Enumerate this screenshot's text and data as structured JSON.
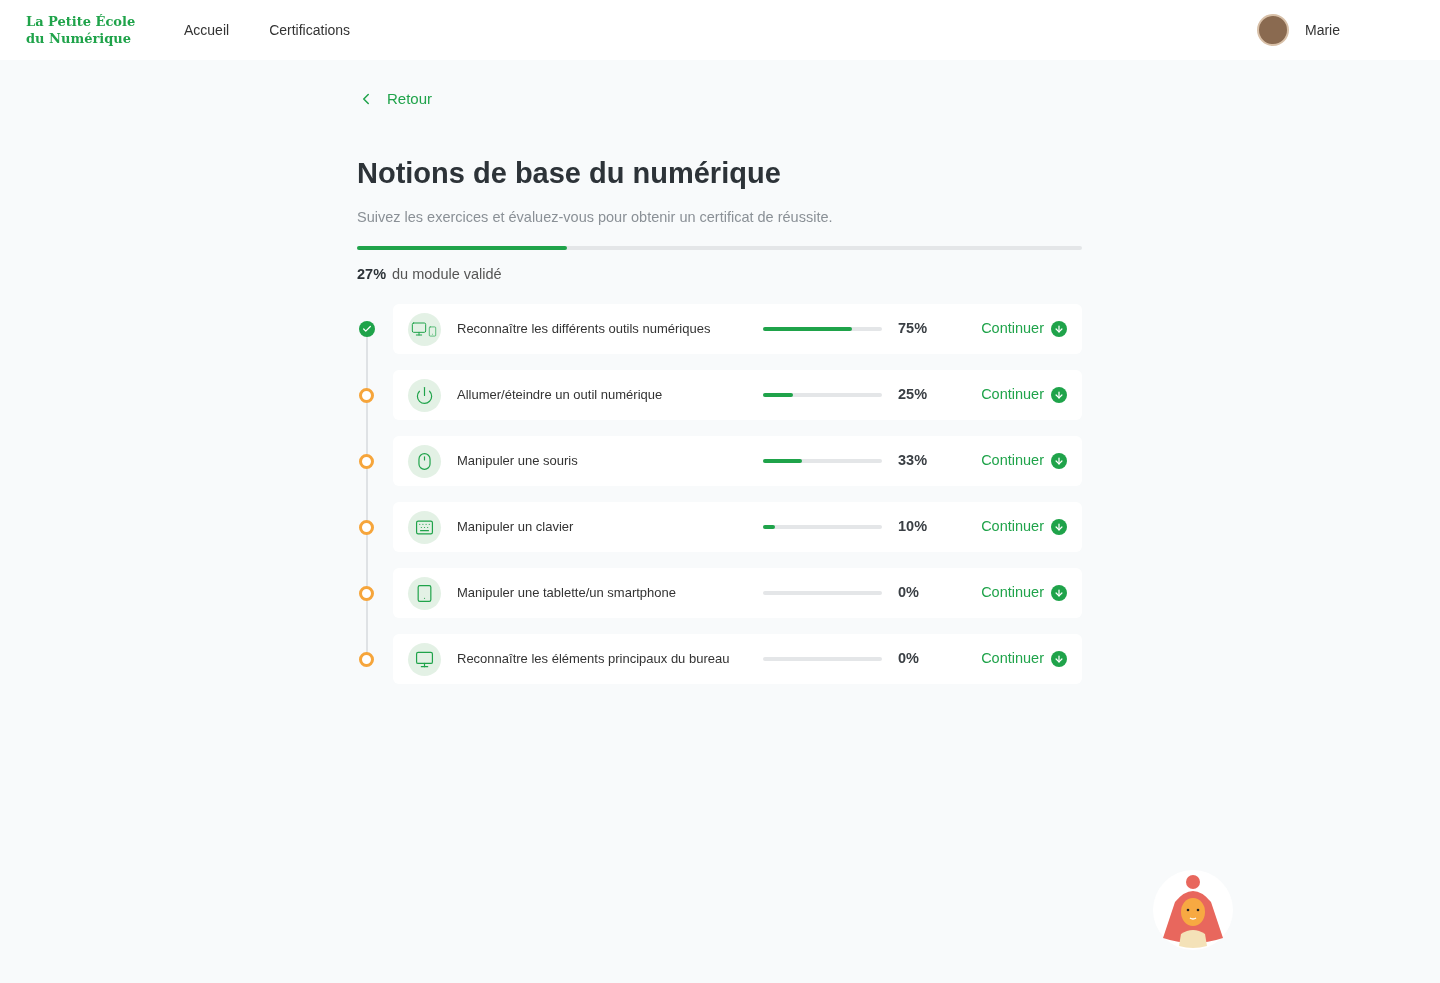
{
  "header": {
    "logo": [
      "La Petite École",
      "du Numérique"
    ],
    "nav": [
      {
        "label": "Accueil",
        "selected": false
      },
      {
        "label": "Certifications",
        "selected": false
      }
    ],
    "user": {
      "name": "Marie"
    }
  },
  "back_link": "Retour",
  "title": "Notions de base du numérique",
  "subtitle": "Suivez les exercices et évaluez-vous pour obtenir un certificat de réussite.",
  "module_progress": {
    "level": 0.29,
    "percent": "27%",
    "label": "du module validé"
  },
  "lessons": [
    {
      "kind": "devices",
      "title": "Reconnaître les différents outils numériques",
      "completed": true,
      "level": 0.75,
      "percent": "75%",
      "action": "Continuer"
    },
    {
      "kind": "power",
      "title": "Allumer/éteindre un outil numérique",
      "completed": false,
      "level": 0.25,
      "percent": "25%",
      "action": "Continuer"
    },
    {
      "kind": "mouse",
      "title": "Manipuler une souris",
      "completed": false,
      "level": 0.33,
      "percent": "33%",
      "action": "Continuer"
    },
    {
      "kind": "keyboard",
      "title": "Manipuler un clavier",
      "completed": false,
      "level": 0.1,
      "percent": "10%",
      "action": "Continuer"
    },
    {
      "kind": "tablet",
      "title": "Manipuler une tablette/un smartphone",
      "completed": false,
      "level": 0,
      "percent": "0%",
      "action": "Continuer"
    },
    {
      "kind": "desktop",
      "title": "Reconnaître les éléments principaux du bureau",
      "completed": false,
      "level": 0,
      "percent": "0%",
      "action": "Continuer"
    }
  ]
}
